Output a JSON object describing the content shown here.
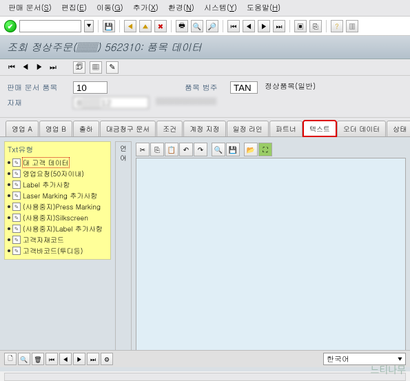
{
  "menu": {
    "items": [
      {
        "label": "판매 문서",
        "key": "S"
      },
      {
        "label": "편집",
        "key": "E"
      },
      {
        "label": "이동",
        "key": "G"
      },
      {
        "label": "추가",
        "key": "X"
      },
      {
        "label": "환경",
        "key": "N"
      },
      {
        "label": "시스템",
        "key": "Y"
      },
      {
        "label": "도움말",
        "key": "H"
      }
    ]
  },
  "title": "조회 정상주문(▒▒) 562310: 품목 데이터",
  "form": {
    "item_label": "판매 문서 품목",
    "item_value": "10",
    "material_label": "자재",
    "material_value": "8▒▒▒12",
    "category_label": "품목 범주",
    "category_value": "TAN",
    "category_text": "정상품목(일반)",
    "material_desc": "▒▒▒▒▒▒▒▒"
  },
  "tabs": [
    "영업 A",
    "영업 B",
    "출하",
    "대금청구 문서",
    "조건",
    "계정 지정",
    "일정 라인",
    "파트너",
    "텍스트",
    "오더 데이터",
    "상태"
  ],
  "active_tab_index": 8,
  "txt_type": {
    "header": "Txt유형",
    "items": [
      "대 고객 데이터",
      "영업요청(50자이내)",
      "Label 추가사항",
      "Laser Marking 추가사항",
      "(사용중지)Press Marking",
      "(사용중지)Silkscreen",
      "(사용중지)Label 추가사항",
      "고객자재코드",
      "고객바코드(투디등)"
    ],
    "selected_index": 0
  },
  "lang_col_header": "언어",
  "editor_toolbar_icons": [
    "cut",
    "copy",
    "paste",
    "undo",
    "redo",
    "find",
    "save",
    "load",
    "expand",
    "exit"
  ],
  "page_toolbar_icons": [
    "new",
    "display",
    "delete",
    "first",
    "prev",
    "next",
    "last",
    "config"
  ],
  "language": "한국어",
  "watermark": "느티나무"
}
